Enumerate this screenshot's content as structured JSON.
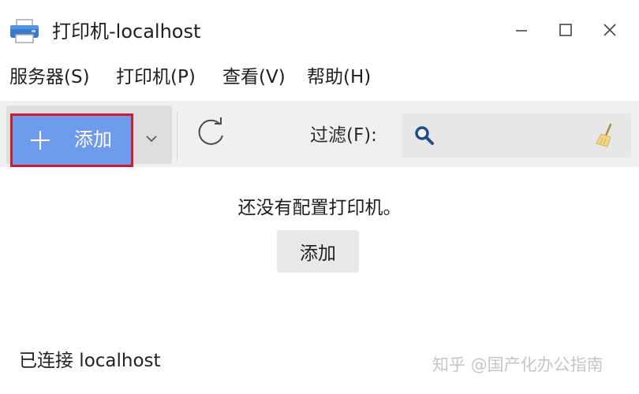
{
  "window": {
    "title": "打印机-localhost",
    "app_icon": "printer-icon",
    "controls": {
      "minimize": "minimize-icon",
      "maximize": "maximize-icon",
      "close": "close-icon"
    }
  },
  "menu": {
    "items": [
      {
        "label": "服务器(S)"
      },
      {
        "label": "打印机(P)"
      },
      {
        "label": "查看(V)"
      },
      {
        "label": "帮助(H)"
      }
    ]
  },
  "toolbar": {
    "add_label": "添加",
    "add_icon": "plus-icon",
    "dropdown_icon": "chevron-down-icon",
    "refresh_icon": "refresh-icon",
    "filter_label": "过滤(F):",
    "filter_value": "",
    "search_icon": "search-icon",
    "clear_icon": "broom-clear-icon",
    "add_highlight_color": "#c81e2d",
    "accent_color": "#6f9bec"
  },
  "main": {
    "empty_message": "还没有配置打印机。",
    "add_button_label": "添加"
  },
  "status": {
    "text": "已连接 localhost"
  },
  "watermark": {
    "text": "知乎 @国产化办公指南"
  }
}
